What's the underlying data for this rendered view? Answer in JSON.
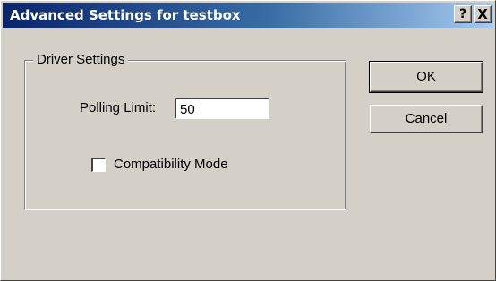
{
  "window": {
    "title": "Advanced Settings for testbox",
    "help_glyph": "?",
    "close_glyph": "X"
  },
  "driver_settings": {
    "group_label": "Driver Settings",
    "polling_limit_label": "Polling Limit:",
    "polling_limit_value": "50",
    "compatibility_mode_label": "Compatibility Mode",
    "compatibility_mode_checked": false
  },
  "buttons": {
    "ok_label": "OK",
    "cancel_label": "Cancel"
  },
  "colors": {
    "dialog_face": "#d4d0c8",
    "title_active_start": "#0a246a",
    "title_active_end": "#a6caf0",
    "title_text": "#ffffff"
  }
}
